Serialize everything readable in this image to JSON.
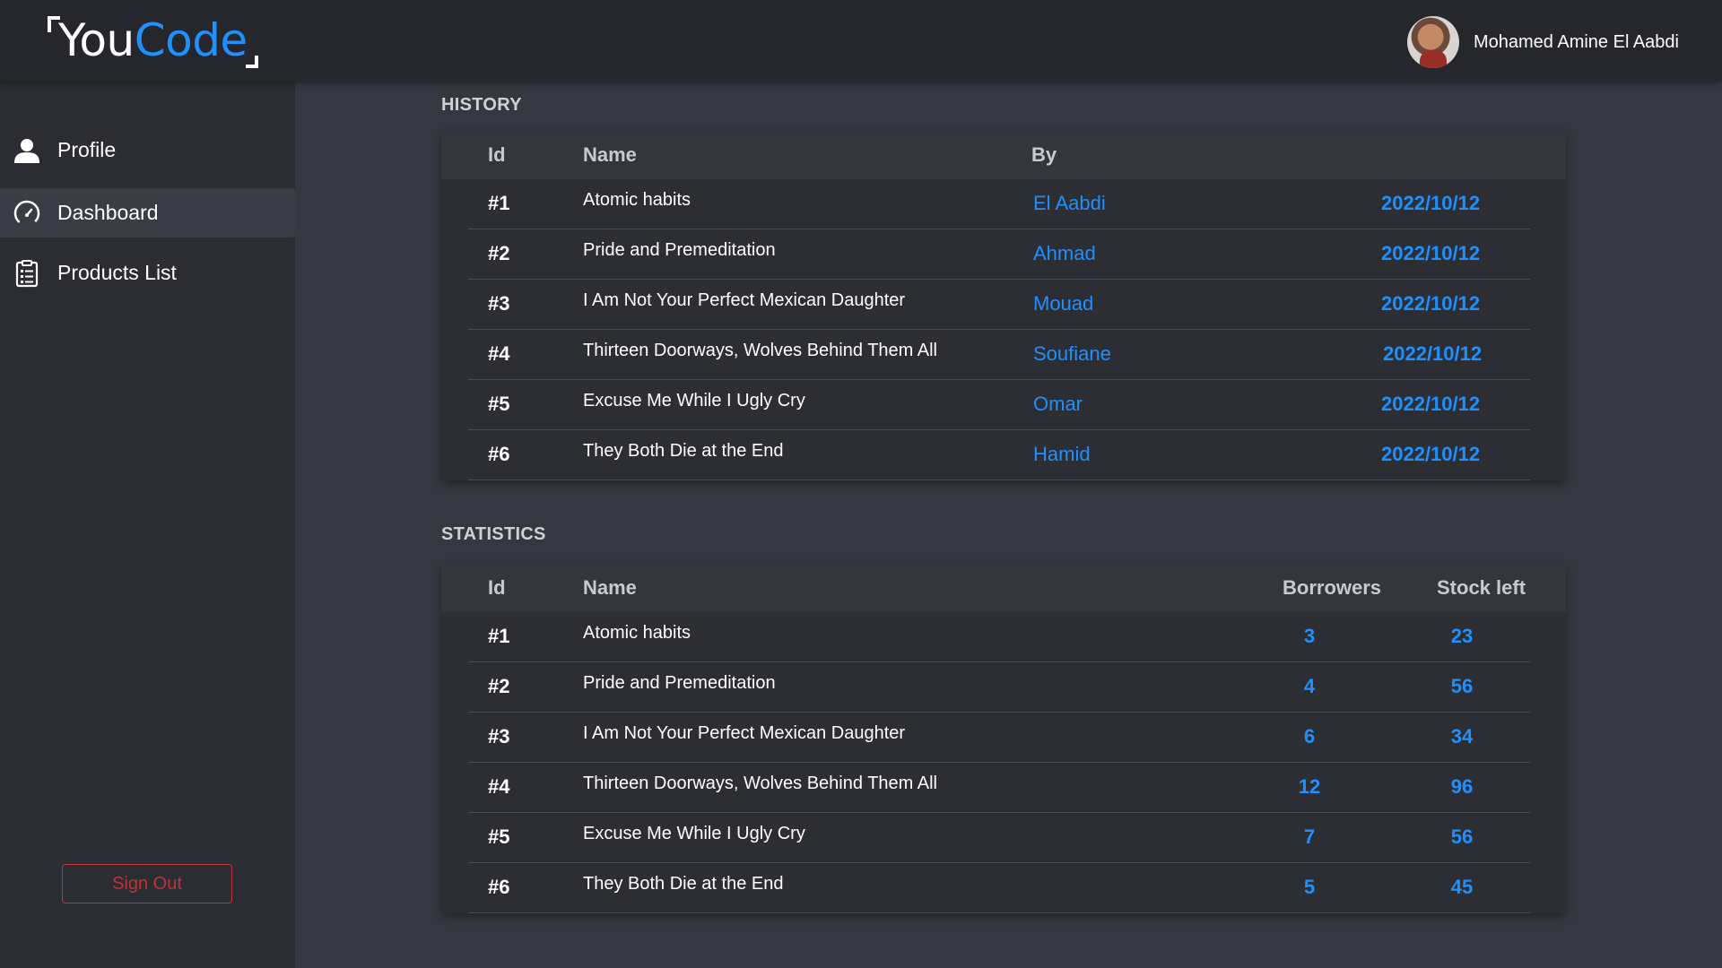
{
  "brand": {
    "logo_you": "You",
    "logo_code": "Code"
  },
  "user": {
    "name": "Mohamed Amine El Aabdi"
  },
  "sidebar": {
    "items": [
      {
        "label": "Profile",
        "icon": "user-icon"
      },
      {
        "label": "Dashboard",
        "icon": "gauge-icon",
        "active": true
      },
      {
        "label": "Products List",
        "icon": "clipboard-list-icon"
      }
    ],
    "signout_label": "Sign Out"
  },
  "history": {
    "title": "HISTORY",
    "columns": {
      "id": "Id",
      "name": "Name",
      "by": "By"
    },
    "rows": [
      {
        "id": "#1",
        "name": "Atomic habits",
        "by": "El Aabdi",
        "date": "2022/10/12"
      },
      {
        "id": "#2",
        "name": "Pride and Premeditation",
        "by": "Ahmad",
        "date": "2022/10/12"
      },
      {
        "id": "#3",
        "name": "I Am Not Your Perfect Mexican Daughter",
        "by": "Mouad",
        "date": "2022/10/12"
      },
      {
        "id": "#4",
        "name": "Thirteen Doorways, Wolves Behind Them All",
        "by": "Soufiane",
        "date": "2022/10/12"
      },
      {
        "id": "#5",
        "name": "Excuse Me While I Ugly Cry",
        "by": "Omar",
        "date": "2022/10/12"
      },
      {
        "id": "#6",
        "name": "They Both Die at the End",
        "by": "Hamid",
        "date": "2022/10/12"
      }
    ]
  },
  "statistics": {
    "title": "STATISTICS",
    "columns": {
      "id": "Id",
      "name": "Name",
      "borrowers": "Borrowers",
      "stock": "Stock left"
    },
    "rows": [
      {
        "id": "#1",
        "name": "Atomic habits",
        "borrowers": "3",
        "stock": "23"
      },
      {
        "id": "#2",
        "name": "Pride and Premeditation",
        "borrowers": "4",
        "stock": "56"
      },
      {
        "id": "#3",
        "name": "I Am Not Your Perfect Mexican Daughter",
        "borrowers": "6",
        "stock": "34"
      },
      {
        "id": "#4",
        "name": "Thirteen Doorways, Wolves Behind Them All",
        "borrowers": "12",
        "stock": "96"
      },
      {
        "id": "#5",
        "name": "Excuse Me While I Ugly Cry",
        "borrowers": "7",
        "stock": "56"
      },
      {
        "id": "#6",
        "name": "They Both Die at the End",
        "borrowers": "5",
        "stock": "45"
      }
    ]
  },
  "colors": {
    "accent": "#1e90ff",
    "danger": "#c0323a",
    "topbar": "#25272c",
    "sidebar": "#2b2d33",
    "main": "#353841"
  }
}
